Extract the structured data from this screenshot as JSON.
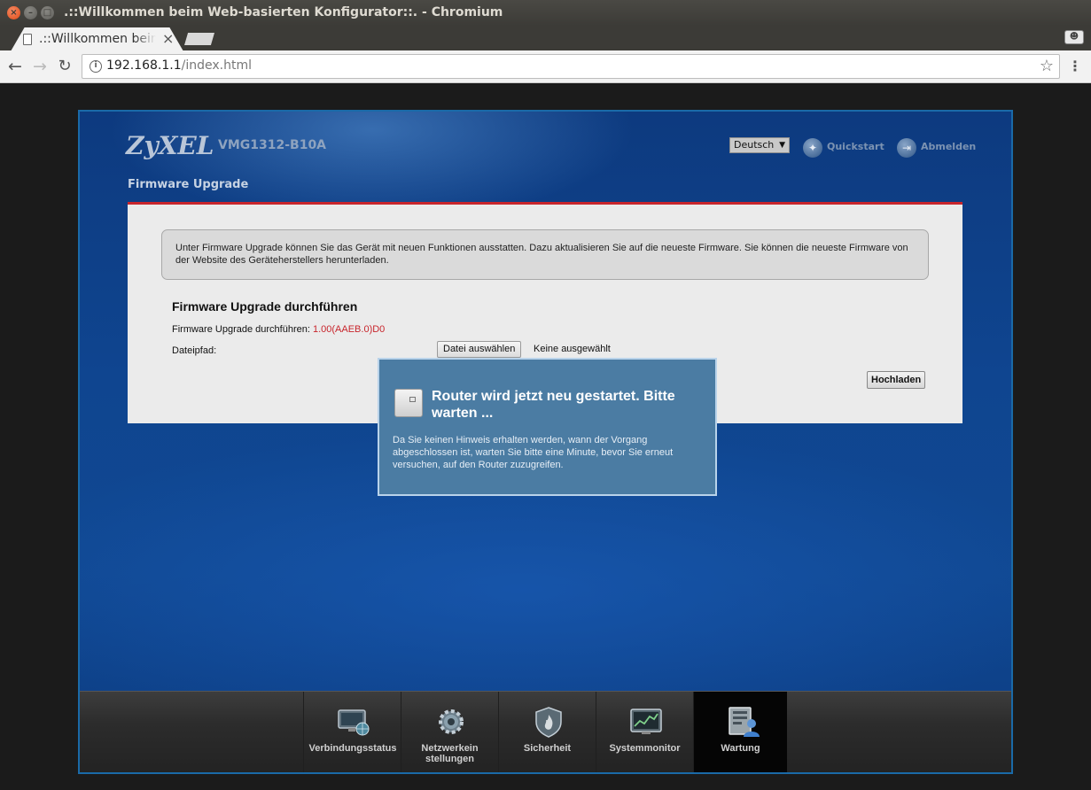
{
  "window": {
    "title": ".::Willkommen beim Web-basierten Konfigurator::. - Chromium"
  },
  "browser": {
    "tab_title": ".::Willkommen beim Web-basierten Konfigurator::.",
    "url_host": "192.168.1.1",
    "url_path": "/index.html"
  },
  "header": {
    "logo": "ZyXEL",
    "model": "VMG1312-B10A",
    "language": "Deutsch",
    "quickstart": "Quickstart",
    "logout": "Abmelden"
  },
  "page": {
    "heading": "Firmware Upgrade",
    "info": "Unter Firmware Upgrade können Sie das Gerät mit neuen Funktionen ausstatten. Dazu aktualisieren Sie auf die neueste Firmware. Sie können die neueste Firmware von der Website des Geräteherstellers herunterladen.",
    "section_title": "Firmware Upgrade durchführen",
    "current_label": "Firmware Upgrade durchführen:",
    "current_version": "1.00(AAEB.0)D0",
    "path_label": "Dateipfad:",
    "file_button": "Datei auswählen",
    "file_none": "Keine ausgewählt",
    "upload_button": "Hochladen"
  },
  "modal": {
    "title": "Router wird jetzt neu gestartet. Bitte warten ...",
    "body": "Da Sie keinen Hinweis erhalten werden, wann der Vorgang abgeschlossen ist, warten Sie bitte eine Minute, bevor Sie erneut versuchen, auf den Router zuzugreifen."
  },
  "bottom_nav": {
    "items": [
      {
        "label": "Verbindungsstatus",
        "icon": "monitor-globe-icon"
      },
      {
        "label": "Netzwerkein stellungen",
        "icon": "gear-icon"
      },
      {
        "label": "Sicherheit",
        "icon": "shield-fire-icon"
      },
      {
        "label": "Systemmonitor",
        "icon": "chart-monitor-icon"
      },
      {
        "label": "Wartung",
        "icon": "maintenance-user-icon",
        "active": true
      }
    ]
  },
  "colors": {
    "frame_bg": "#0f3f87",
    "accent_red": "#c8252c",
    "modal_bg": "#4b7ca3"
  }
}
